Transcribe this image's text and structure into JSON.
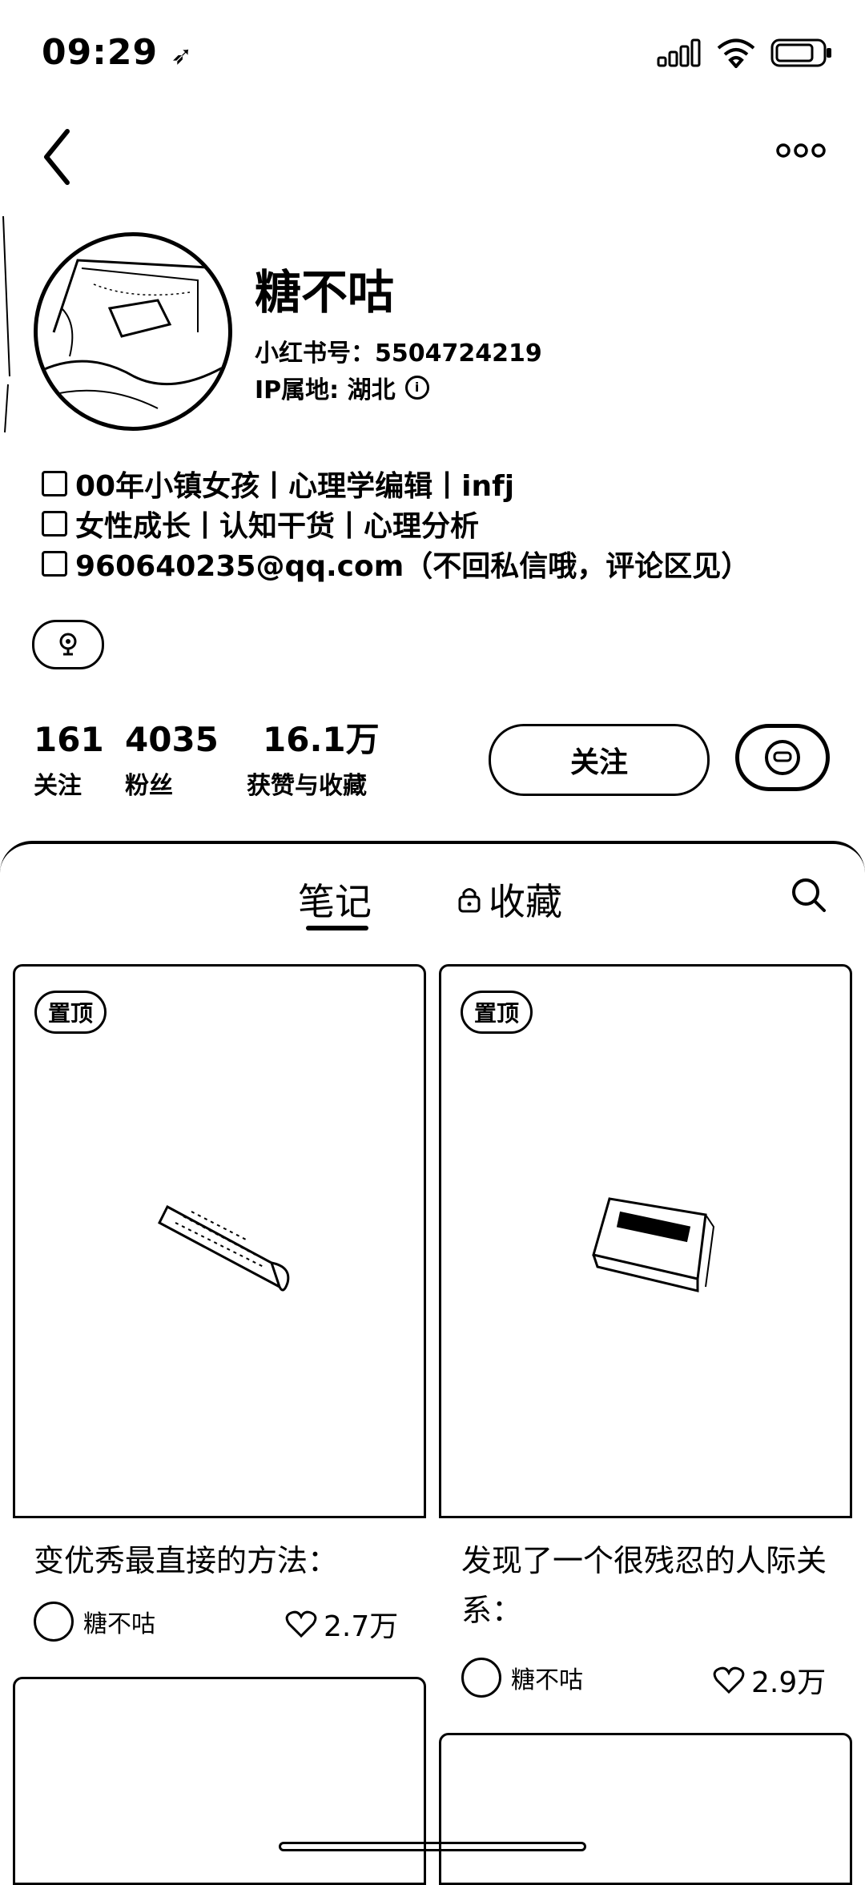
{
  "status_bar": {
    "time": "09:29"
  },
  "profile": {
    "name": "糖不咕",
    "red_id": "小红书号：5504724219",
    "ip_location": "IP属地: 湖北",
    "bio": [
      "00年小镇女孩丨心理学编辑丨infj",
      "女性成长丨认知干货丨心理分析",
      "960640235@qq.com（不回私信哦，评论区见）"
    ]
  },
  "stats": [
    {
      "value": "161",
      "label": "关注"
    },
    {
      "value": "4035",
      "label": "粉丝"
    },
    {
      "value": "16.1万",
      "label": "获赞与收藏"
    }
  ],
  "actions": {
    "follow_label": "关注"
  },
  "tabs": [
    {
      "label": "笔记",
      "active": true
    },
    {
      "label": "收藏",
      "locked": true
    }
  ],
  "notes": [
    {
      "pinned_label": "置顶",
      "title": "变优秀最直接的方法：",
      "author": "糖不咕",
      "likes": "2.7万"
    },
    {
      "pinned_label": "置顶",
      "title": "发现了一个很残忍的人际关系：",
      "author": "糖不咕",
      "likes": "2.9万"
    }
  ],
  "colors": {
    "foreground": "#000000",
    "background": "#ffffff"
  }
}
